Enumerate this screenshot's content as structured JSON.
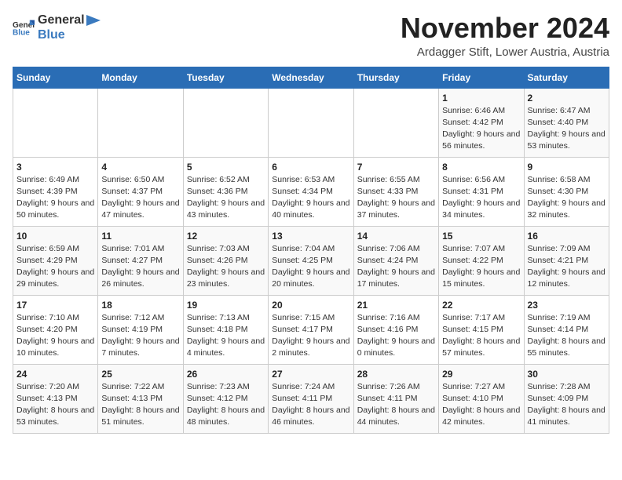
{
  "header": {
    "logo_general": "General",
    "logo_blue": "Blue",
    "title": "November 2024",
    "subtitle": "Ardagger Stift, Lower Austria, Austria"
  },
  "calendar": {
    "days_of_week": [
      "Sunday",
      "Monday",
      "Tuesday",
      "Wednesday",
      "Thursday",
      "Friday",
      "Saturday"
    ],
    "weeks": [
      [
        {
          "day": "",
          "details": ""
        },
        {
          "day": "",
          "details": ""
        },
        {
          "day": "",
          "details": ""
        },
        {
          "day": "",
          "details": ""
        },
        {
          "day": "",
          "details": ""
        },
        {
          "day": "1",
          "details": "Sunrise: 6:46 AM\nSunset: 4:42 PM\nDaylight: 9 hours and 56 minutes."
        },
        {
          "day": "2",
          "details": "Sunrise: 6:47 AM\nSunset: 4:40 PM\nDaylight: 9 hours and 53 minutes."
        }
      ],
      [
        {
          "day": "3",
          "details": "Sunrise: 6:49 AM\nSunset: 4:39 PM\nDaylight: 9 hours and 50 minutes."
        },
        {
          "day": "4",
          "details": "Sunrise: 6:50 AM\nSunset: 4:37 PM\nDaylight: 9 hours and 47 minutes."
        },
        {
          "day": "5",
          "details": "Sunrise: 6:52 AM\nSunset: 4:36 PM\nDaylight: 9 hours and 43 minutes."
        },
        {
          "day": "6",
          "details": "Sunrise: 6:53 AM\nSunset: 4:34 PM\nDaylight: 9 hours and 40 minutes."
        },
        {
          "day": "7",
          "details": "Sunrise: 6:55 AM\nSunset: 4:33 PM\nDaylight: 9 hours and 37 minutes."
        },
        {
          "day": "8",
          "details": "Sunrise: 6:56 AM\nSunset: 4:31 PM\nDaylight: 9 hours and 34 minutes."
        },
        {
          "day": "9",
          "details": "Sunrise: 6:58 AM\nSunset: 4:30 PM\nDaylight: 9 hours and 32 minutes."
        }
      ],
      [
        {
          "day": "10",
          "details": "Sunrise: 6:59 AM\nSunset: 4:29 PM\nDaylight: 9 hours and 29 minutes."
        },
        {
          "day": "11",
          "details": "Sunrise: 7:01 AM\nSunset: 4:27 PM\nDaylight: 9 hours and 26 minutes."
        },
        {
          "day": "12",
          "details": "Sunrise: 7:03 AM\nSunset: 4:26 PM\nDaylight: 9 hours and 23 minutes."
        },
        {
          "day": "13",
          "details": "Sunrise: 7:04 AM\nSunset: 4:25 PM\nDaylight: 9 hours and 20 minutes."
        },
        {
          "day": "14",
          "details": "Sunrise: 7:06 AM\nSunset: 4:24 PM\nDaylight: 9 hours and 17 minutes."
        },
        {
          "day": "15",
          "details": "Sunrise: 7:07 AM\nSunset: 4:22 PM\nDaylight: 9 hours and 15 minutes."
        },
        {
          "day": "16",
          "details": "Sunrise: 7:09 AM\nSunset: 4:21 PM\nDaylight: 9 hours and 12 minutes."
        }
      ],
      [
        {
          "day": "17",
          "details": "Sunrise: 7:10 AM\nSunset: 4:20 PM\nDaylight: 9 hours and 10 minutes."
        },
        {
          "day": "18",
          "details": "Sunrise: 7:12 AM\nSunset: 4:19 PM\nDaylight: 9 hours and 7 minutes."
        },
        {
          "day": "19",
          "details": "Sunrise: 7:13 AM\nSunset: 4:18 PM\nDaylight: 9 hours and 4 minutes."
        },
        {
          "day": "20",
          "details": "Sunrise: 7:15 AM\nSunset: 4:17 PM\nDaylight: 9 hours and 2 minutes."
        },
        {
          "day": "21",
          "details": "Sunrise: 7:16 AM\nSunset: 4:16 PM\nDaylight: 9 hours and 0 minutes."
        },
        {
          "day": "22",
          "details": "Sunrise: 7:17 AM\nSunset: 4:15 PM\nDaylight: 8 hours and 57 minutes."
        },
        {
          "day": "23",
          "details": "Sunrise: 7:19 AM\nSunset: 4:14 PM\nDaylight: 8 hours and 55 minutes."
        }
      ],
      [
        {
          "day": "24",
          "details": "Sunrise: 7:20 AM\nSunset: 4:13 PM\nDaylight: 8 hours and 53 minutes."
        },
        {
          "day": "25",
          "details": "Sunrise: 7:22 AM\nSunset: 4:13 PM\nDaylight: 8 hours and 51 minutes."
        },
        {
          "day": "26",
          "details": "Sunrise: 7:23 AM\nSunset: 4:12 PM\nDaylight: 8 hours and 48 minutes."
        },
        {
          "day": "27",
          "details": "Sunrise: 7:24 AM\nSunset: 4:11 PM\nDaylight: 8 hours and 46 minutes."
        },
        {
          "day": "28",
          "details": "Sunrise: 7:26 AM\nSunset: 4:11 PM\nDaylight: 8 hours and 44 minutes."
        },
        {
          "day": "29",
          "details": "Sunrise: 7:27 AM\nSunset: 4:10 PM\nDaylight: 8 hours and 42 minutes."
        },
        {
          "day": "30",
          "details": "Sunrise: 7:28 AM\nSunset: 4:09 PM\nDaylight: 8 hours and 41 minutes."
        }
      ]
    ]
  }
}
